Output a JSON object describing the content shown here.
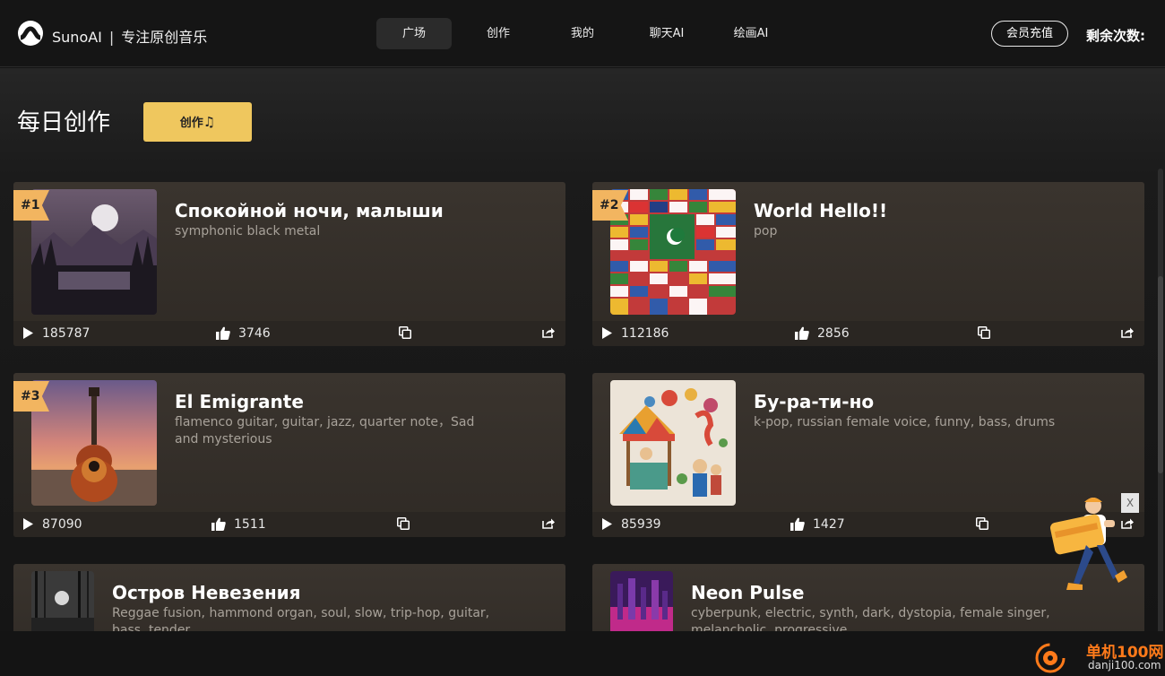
{
  "brand": {
    "name": "SunoAI",
    "separator": "|",
    "tagline": "专注原创音乐"
  },
  "nav": {
    "items": [
      "广场",
      "创作",
      "我的",
      "聊天AI",
      "绘画AI"
    ],
    "active": "广场"
  },
  "header": {
    "recharge_label": "会员充值",
    "remaining_label": "剩余次数:"
  },
  "main": {
    "title": "每日创作",
    "create_label": "创作",
    "create_icon": "music-note-icon"
  },
  "songs": [
    {
      "rank": "#1",
      "title": "Спокойной ночи, малыши",
      "tags": "symphonic black metal",
      "plays": "185787",
      "likes": "3746"
    },
    {
      "rank": "#2",
      "title": "World Hello!!",
      "tags": "pop",
      "plays": "112186",
      "likes": "2856"
    },
    {
      "rank": "#3",
      "title": "El Emigrante",
      "tags": "flamenco guitar, guitar, jazz, quarter note，Sad and mysterious",
      "plays": "87090",
      "likes": "1511"
    },
    {
      "rank": "",
      "title": "Бу-ра-ти-но",
      "tags": "k-pop, russian female voice, funny, bass, drums",
      "plays": "85939",
      "likes": "1427"
    },
    {
      "rank": "",
      "title": "Остров Невезения",
      "tags": "Reggae fusion, hammond organ, soul, slow, trip-hop, guitar, bass, tender"
    },
    {
      "rank": "",
      "title": "Neon Pulse",
      "tags": "cyberpunk, electric, synth, dark, dystopia, female singer, melancholic, progressive"
    }
  ],
  "promo": {
    "close_label": "X"
  },
  "watermark": {
    "line1": "单机100网",
    "line2": "danji100.com"
  },
  "colors": {
    "accent": "#efc75e",
    "rank_badge": "#f2b560",
    "card_bg": "#3a342e",
    "background": "#141414"
  }
}
